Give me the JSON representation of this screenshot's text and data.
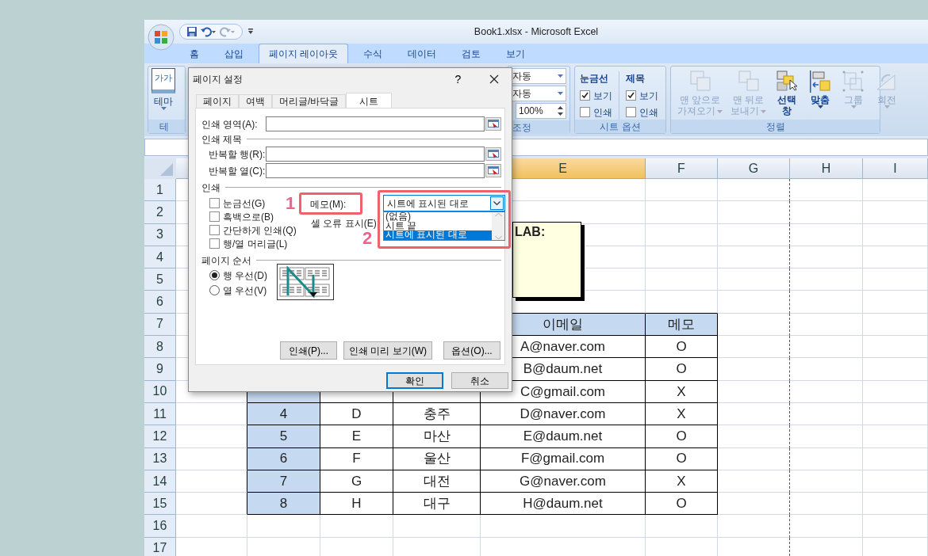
{
  "window": {
    "title": "Book1.xlsx  -  Microsoft Excel"
  },
  "ribbon_tabs": [
    {
      "label": "홈",
      "selected": false
    },
    {
      "label": "삽입",
      "selected": false
    },
    {
      "label": "페이지 레이아웃",
      "selected": true
    },
    {
      "label": "수식",
      "selected": false
    },
    {
      "label": "데이터",
      "selected": false
    },
    {
      "label": "검토",
      "selected": false
    },
    {
      "label": "보기",
      "selected": false
    }
  ],
  "ribbon": {
    "theme_group": {
      "icon_text": "가가",
      "button": "테마",
      "label": "테"
    },
    "scale_group": {
      "width": "자동",
      "height": "자동",
      "scale": "100%",
      "label": "조정"
    },
    "sheet_options": {
      "label": "시트 옵션",
      "columns": [
        {
          "title": "눈금선",
          "options": [
            {
              "label": "보기",
              "checked": true
            },
            {
              "label": "인쇄",
              "checked": false
            }
          ]
        },
        {
          "title": "제목",
          "options": [
            {
              "label": "보기",
              "checked": true
            },
            {
              "label": "인쇄",
              "checked": false
            }
          ]
        }
      ]
    },
    "arrange": {
      "label": "정렬",
      "buttons": [
        {
          "kind": "front",
          "lines": [
            "맨 앞으로",
            "가져오기"
          ],
          "disabled": true,
          "dropdown": true
        },
        {
          "kind": "back",
          "lines": [
            "맨 뒤로",
            "보내기"
          ],
          "disabled": true,
          "dropdown": true
        },
        {
          "kind": "pane",
          "lines": [
            "선택",
            "창"
          ],
          "disabled": false,
          "dropdown": false
        },
        {
          "kind": "align",
          "lines": [
            "맞춤"
          ],
          "disabled": false,
          "dropdown": true
        },
        {
          "kind": "group",
          "lines": [
            "그룹"
          ],
          "disabled": true,
          "dropdown": true
        },
        {
          "kind": "rotate",
          "lines": [
            "회전"
          ],
          "disabled": true,
          "dropdown": true
        }
      ]
    }
  },
  "sheet": {
    "columns": [
      {
        "label": "E",
        "selected": true
      },
      {
        "label": "F",
        "selected": false
      },
      {
        "label": "G",
        "selected": false
      },
      {
        "label": "H",
        "selected": false
      },
      {
        "label": "I",
        "selected": false
      }
    ],
    "rows": [
      "1",
      "2",
      "3",
      "4",
      "5",
      "6",
      "7",
      "8",
      "9",
      "10",
      "11",
      "12",
      "13",
      "14",
      "15",
      "16",
      "17"
    ],
    "comment": "LAB:",
    "table": {
      "header": {
        "email": "이메일",
        "memo": "메모"
      },
      "rows": [
        {
          "email": "A@naver.com",
          "memo": "O"
        },
        {
          "email": "B@daum.net",
          "memo": "O"
        },
        {
          "email": "C@gmail.com",
          "memo": "X"
        },
        {
          "no": "4",
          "name": "D",
          "city": "충주",
          "email": "D@naver.com",
          "memo": "X"
        },
        {
          "no": "5",
          "name": "E",
          "city": "마산",
          "email": "E@daum.net",
          "memo": "O"
        },
        {
          "no": "6",
          "name": "F",
          "city": "울산",
          "email": "F@gmail.com",
          "memo": "O"
        },
        {
          "no": "7",
          "name": "G",
          "city": "대전",
          "email": "G@naver.com",
          "memo": "X"
        },
        {
          "no": "8",
          "name": "H",
          "city": "대구",
          "email": "H@daum.net",
          "memo": "O"
        }
      ]
    }
  },
  "dialog": {
    "title": "페이지 설정",
    "help": "?",
    "tabs": [
      {
        "label": "페이지",
        "selected": false
      },
      {
        "label": "여백",
        "selected": false
      },
      {
        "label": "머리글/바닥글",
        "selected": false
      },
      {
        "label": "시트",
        "selected": true
      }
    ],
    "print_area": {
      "label": "인쇄 영역(A):"
    },
    "print_titles": {
      "title": "인쇄 제목",
      "fields": [
        {
          "label": "반복할 행(R):"
        },
        {
          "label": "반복할 열(C):"
        }
      ]
    },
    "print": {
      "title": "인쇄",
      "options": [
        {
          "label": "눈금선(G)",
          "checked": false
        },
        {
          "label": "흑백으로(B)",
          "checked": false
        },
        {
          "label": "간단하게 인쇄(Q)",
          "checked": false
        },
        {
          "label": "행/열 머리글(L)",
          "checked": false
        }
      ],
      "comments": {
        "label": "메모(M):",
        "value": "시트에 표시된 대로",
        "options": [
          {
            "label": "(없음)",
            "selected": false
          },
          {
            "label": "시트 끝",
            "selected": false
          },
          {
            "label": "시트에 표시된 대로",
            "selected": true
          }
        ]
      },
      "errors": {
        "label": "셀 오류 표시(E):"
      }
    },
    "page_order": {
      "title": "페이지 순서",
      "options": [
        {
          "label": "행 우선(D)",
          "selected": true
        },
        {
          "label": "열 우선(V)",
          "selected": false
        }
      ]
    },
    "buttons": [
      {
        "label": "인쇄(P)..."
      },
      {
        "label": "인쇄 미리 보기(W)"
      },
      {
        "label": "옵션(O)..."
      }
    ],
    "footer_buttons": [
      {
        "label": "확인",
        "default": true
      },
      {
        "label": "취소",
        "default": false
      }
    ]
  },
  "annotations": [
    {
      "number": "1"
    },
    {
      "number": "2"
    }
  ]
}
